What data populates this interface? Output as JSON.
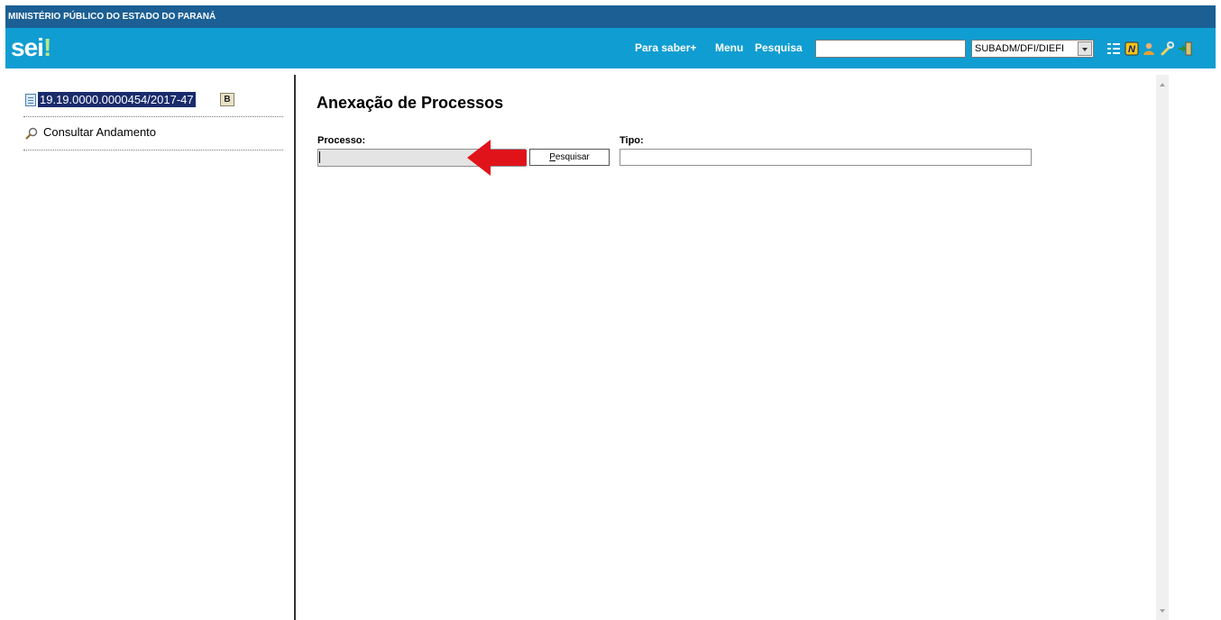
{
  "header": {
    "organization": "MINISTÉRIO PÚBLICO DO ESTADO DO PARANÁ",
    "logo_text": "sei",
    "logo_mark": "!",
    "nav": {
      "para_saber": "Para saber+",
      "menu": "Menu",
      "pesquisa": "Pesquisa"
    },
    "search_value": "",
    "unit_selected": "SUBADM/DFI/DIEFI",
    "icons": [
      "list-icon",
      "new-icon",
      "user-icon",
      "tools-icon",
      "exit-icon"
    ]
  },
  "sidebar": {
    "process_number": "19.19.0000.0000454/2017-47",
    "badge": "B",
    "consult_label": "Consultar Andamento"
  },
  "main": {
    "title": "Anexação de Processos",
    "processo_label": "Processo:",
    "processo_value": "",
    "search_button": "Pesquisar",
    "search_button_access_key": "P",
    "search_button_rest": "esquisar",
    "tipo_label": "Tipo:",
    "tipo_value": ""
  },
  "colors": {
    "org_bar": "#1b5f94",
    "topbar": "#109dd2",
    "selected_process": "#1a2b6b",
    "arrow": "#e0131b"
  }
}
